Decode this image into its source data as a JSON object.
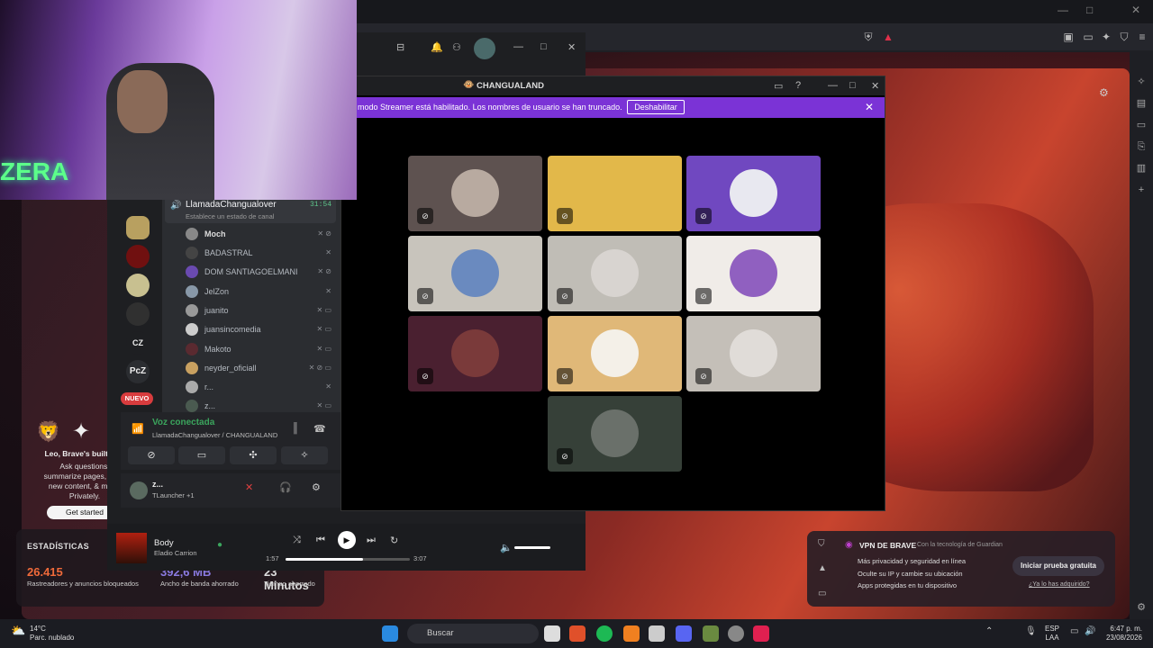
{
  "brave": {
    "new_tab": {
      "leo_title": "Leo, Brave's built-in A",
      "leo_desc_1": "Ask questions,",
      "leo_desc_2": "summarize pages, creat",
      "leo_desc_3": "new content, & more.",
      "leo_desc_4": "Privately.",
      "leo_button": "Get started",
      "stats_title": "ESTADÍSTICAS",
      "stat1_value": "26.415",
      "stat1_label": "Rastreadores y anuncios bloqueados",
      "stat2_value": "392,6 MB",
      "stat2_label": "Ancho de banda ahorrado",
      "stat3_value": "23 Minutos",
      "stat3_label": "Tiempo ahorrado",
      "vpn_title": "VPN DE BRAVE",
      "vpn_powered": "Con la tecnología de  Guardian",
      "vpn_features": [
        "Más privacidad y seguridad en línea",
        "Oculte su IP y cambie su ubicación",
        "Apps protegidas en tu dispositivo"
      ],
      "vpn_button": "Iniciar prueba gratuita",
      "vpn_link": "¿Ya lo has adquirido?"
    }
  },
  "discord": {
    "guild_labels": [
      "CZ",
      "PcZ"
    ],
    "new_badge": "NUEVO",
    "channel_name": "LlamadaChangualover",
    "channel_status": "Establece un estado de canal",
    "timer": "31:54",
    "users": [
      "Moch",
      "BADASTRAL",
      "DOM SANTIAGOELMANI",
      "JelZon",
      "juanito",
      "juansincomedia",
      "Makoto",
      "neyder_oficiall",
      "r...",
      "z..."
    ],
    "voice_status": "Voz conectada",
    "voice_detail": "LlamadaChangualover / CHANGUALAND",
    "self_name": "z...",
    "self_activity": "TLauncher +1",
    "now_playing_title": "Body",
    "now_playing_artist": "Eladio Carrion",
    "time_current": "1:57",
    "time_total": "3:07",
    "progress": 0.62
  },
  "stream": {
    "title": "CHANGUALAND",
    "banner_text": "modo Streamer está habilitado. Los nombres de usuario se han truncado.",
    "banner_button": "Deshabilitar"
  },
  "taskbar": {
    "weather_temp": "14°C",
    "weather_desc": "Parc. nublado",
    "search_placeholder": "Buscar",
    "lang_1": "ESP",
    "lang_2": "LAA",
    "time": "6:47 p. m.",
    "date": "23/08/2026"
  },
  "webcam_neon_text": "ZERA"
}
